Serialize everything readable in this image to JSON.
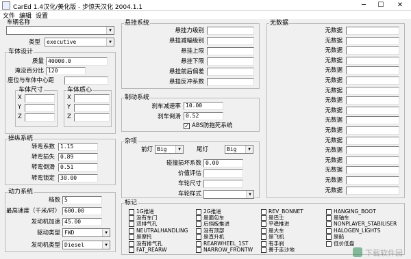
{
  "window": {
    "title": "CarEd 1.4汉化/美化版 - 步惊天汉化 2004.1.1",
    "min": "─",
    "max": "☐",
    "close": "✕"
  },
  "menu": [
    "文件",
    "编辑",
    "设置"
  ],
  "vehicle": {
    "name_label": "车辆名称",
    "name_value": "",
    "type_label": "类型",
    "type_value": "executive"
  },
  "body_design": {
    "title": "车体设计",
    "mass_label": "质量",
    "mass_value": "40000.0",
    "submerge_label": "淹没百分比",
    "submerge_value": "120",
    "seat_label": "座位与车体中心距",
    "seat_value": "",
    "dims_title": "车体尺寸",
    "com_title": "车体质心",
    "axes": [
      "X",
      "Y",
      "Z"
    ]
  },
  "handling": {
    "title": "操纵系统",
    "rows": [
      {
        "label": "转弯系数",
        "value": "1.15"
      },
      {
        "label": "转弯损失",
        "value": "0.89"
      },
      {
        "label": "转弯倒滑",
        "value": "0.51"
      },
      {
        "label": "转弯锁定",
        "value": "30.00"
      }
    ]
  },
  "power": {
    "title": "动力系统",
    "gears_label": "档数",
    "gears_value": "5",
    "speed_label": "最高速度（千米/时）",
    "speed_value": "600.00",
    "accel_label": "发动机加速",
    "accel_value": "45.00",
    "drive_label": "驱动类型",
    "drive_value": "FWD",
    "engine_label": "发动机类型",
    "engine_value": "Diesel"
  },
  "suspension": {
    "title": "悬挂系统",
    "rows": [
      "悬挂力级别",
      "悬挂减幅级别",
      "悬挂上限",
      "悬挂下限",
      "悬挂前后偏差",
      "悬挂反冲系数"
    ]
  },
  "brakes": {
    "title": "制动系统",
    "decel_label": "刹车减速率",
    "decel_value": "10.00",
    "bias_label": "刹车倒滑",
    "bias_value": "0.52",
    "abs_label": "ABS防抱死系统",
    "abs_checked": "✓"
  },
  "misc": {
    "title": "杂项",
    "front_light_label": "前灯",
    "front_light_value": "Big",
    "rear_light_label": "尾灯",
    "rear_light_value": "Big",
    "collision_label": "碰撞损坏系数",
    "collision_value": "0.00",
    "price_label": "价值评估",
    "wheel_size_label": "车轮尺寸",
    "wheel_style_label": "车轮样式"
  },
  "nodata": {
    "title": "无数据",
    "label": "无数据",
    "count": 17
  },
  "flags": {
    "title": "标记",
    "col1": [
      "1G推进",
      "没有车门",
      "双排气孔",
      "NEUTRALHANDLING",
      "是摩托",
      "没有排气孔",
      "FAT_REARW"
    ],
    "col2": [
      "2G推进",
      "是面包车",
      "后挡板推进",
      "没有顶部",
      "是直升机",
      "REARWHEEL_1ST",
      "NARROW_FRONTW"
    ],
    "col3": [
      "REV_BONNET",
      "是巴士",
      "平稳推进",
      "是大车",
      "是飞机",
      "有手刹",
      "善于走沙地"
    ],
    "col4": [
      "HANGING_BOOT",
      "是轴车",
      "NONPLAYER_STABILISER",
      "HALOGEN_LIGHTS",
      "是船",
      "低价低盘"
    ]
  }
}
